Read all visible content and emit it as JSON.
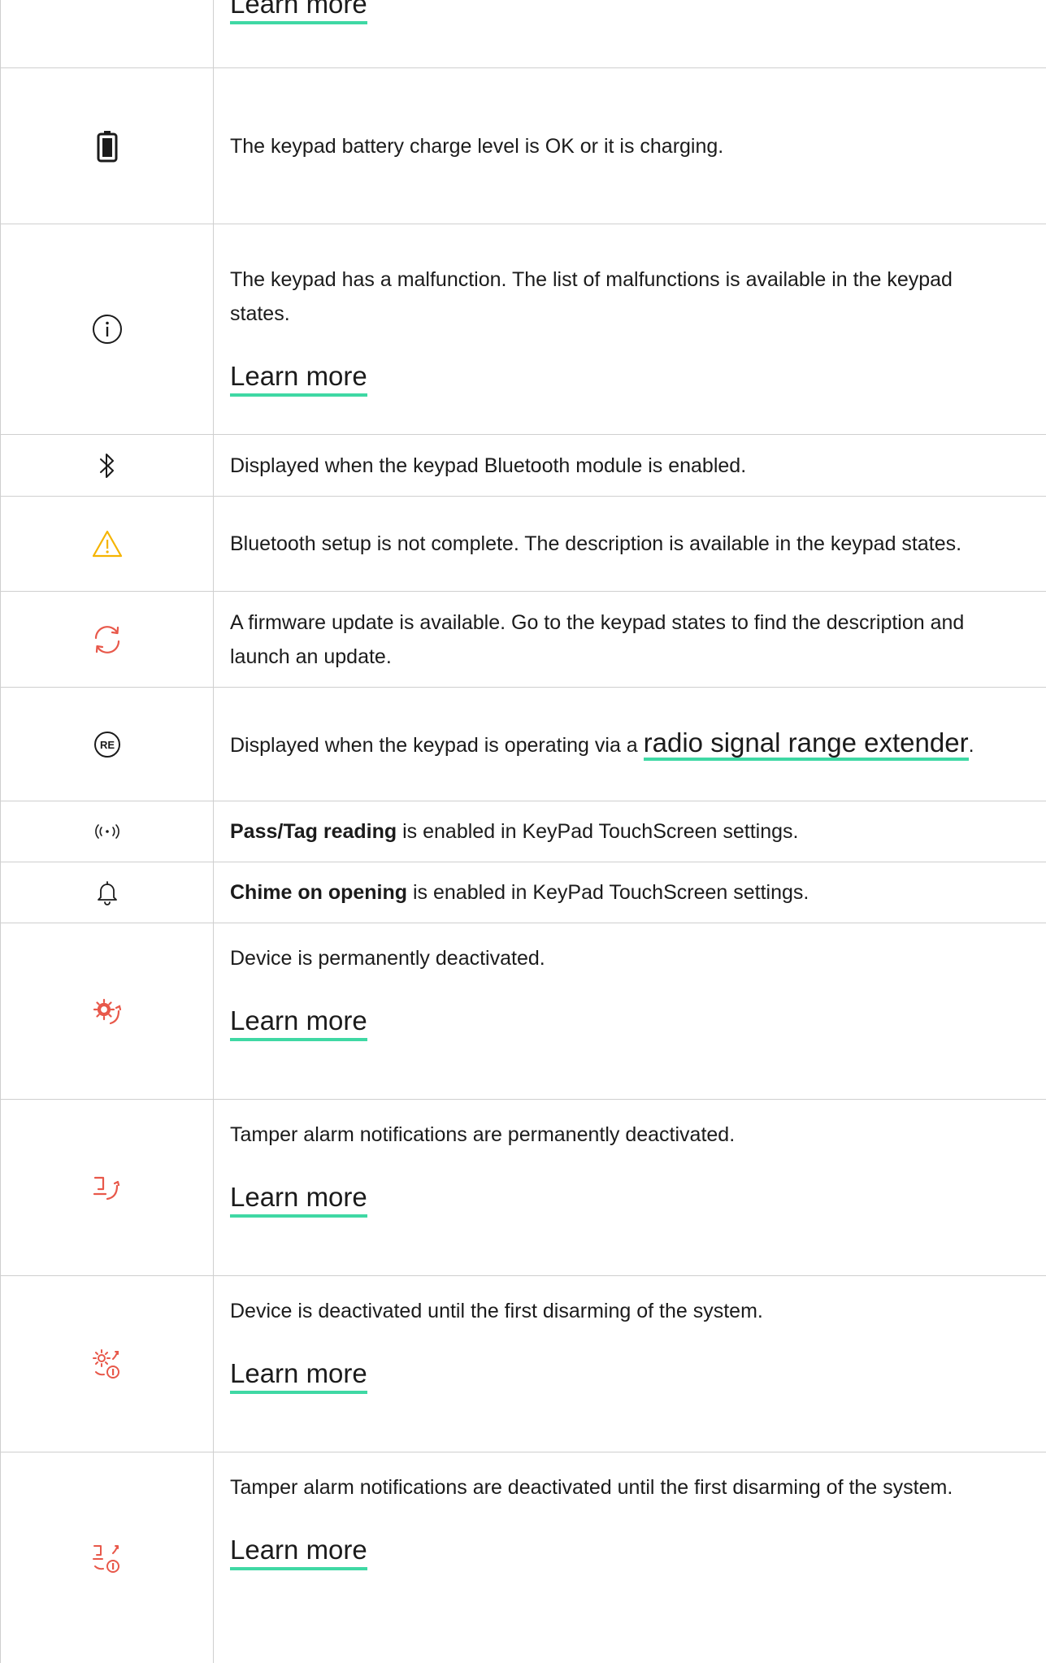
{
  "rows": [
    {
      "icon": "none",
      "learn": "Learn more"
    },
    {
      "icon": "battery-icon",
      "text": "The keypad battery charge level is OK or it is charging."
    },
    {
      "icon": "info-icon",
      "text": "The keypad has a malfunction. The list of malfunctions is available in the keypad states.",
      "learn": "Learn more"
    },
    {
      "icon": "bluetooth-icon",
      "text": "Displayed when the keypad Bluetooth module is enabled."
    },
    {
      "icon": "warning-icon",
      "text": "Bluetooth setup is not complete. The description is available in the keypad states.",
      "color": "#f5b400"
    },
    {
      "icon": "update-icon",
      "text": "A firmware update is available. Go to the keypad states to find the description and launch an update.",
      "color": "#e8584a"
    },
    {
      "icon": "re-icon",
      "text_before": "Displayed when the keypad is operating via a ",
      "link": "radio signal range extender",
      "text_after": "."
    },
    {
      "icon": "pass-tag-icon",
      "bold": "Pass/Tag reading",
      "text": " is enabled in KeyPad TouchScreen settings."
    },
    {
      "icon": "bell-icon",
      "bold": "Chime on opening",
      "text": " is enabled in KeyPad TouchScreen settings."
    },
    {
      "icon": "device-deactivated-icon",
      "text": "Device is permanently deactivated.",
      "learn": "Learn more",
      "color": "#e8584a"
    },
    {
      "icon": "tamper-deactivated-icon",
      "text": "Tamper alarm notifications are permanently deactivated.",
      "learn": "Learn more",
      "color": "#e8584a"
    },
    {
      "icon": "device-deactivated-until-disarm-icon",
      "text": "Device is deactivated until the first disarming of the system.",
      "learn": "Learn more",
      "color": "#e8584a"
    },
    {
      "icon": "tamper-deactivated-until-disarm-icon",
      "text": "Tamper alarm notifications are deactivated until the first disarming of the system.",
      "learn": "Learn more",
      "color": "#e8584a"
    }
  ],
  "colors": {
    "link_underline": "#3fd8a4",
    "border": "#cfcfcf",
    "text": "#1b1b1b"
  }
}
